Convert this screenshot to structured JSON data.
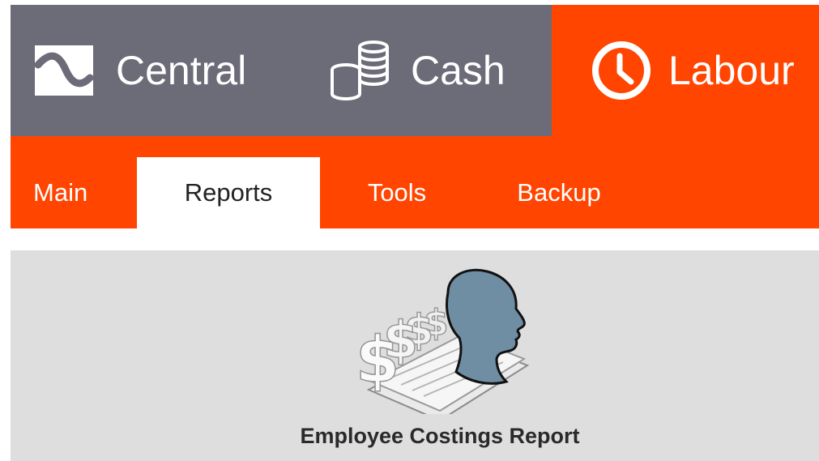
{
  "modules": {
    "central": {
      "label": "Central",
      "icon": "central-logo-icon"
    },
    "cash": {
      "label": "Cash",
      "icon": "coins-stack-icon"
    },
    "labour": {
      "label": "Labour",
      "icon": "clock-icon",
      "active": true
    }
  },
  "tabs": {
    "main": "Main",
    "reports": "Reports",
    "tools": "Tools",
    "backup": "Backup",
    "active": "reports"
  },
  "reports": {
    "items": [
      {
        "label": "Employee Costings Report",
        "icon": "employee-costings-icon"
      }
    ]
  },
  "colors": {
    "accent": "#ff4500",
    "module_bar": "#6c6b78",
    "content_bg": "#dedede",
    "head_fill": "#6f8da3"
  }
}
